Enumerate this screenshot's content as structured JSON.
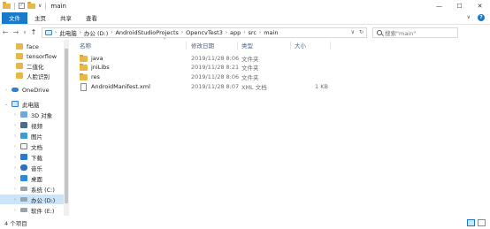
{
  "window": {
    "title": "main",
    "qat_arrow": "∨",
    "minimize": "—",
    "maximize": "☐",
    "close": "✕"
  },
  "ribbon": {
    "tabs": [
      "文件",
      "主页",
      "共享",
      "查看"
    ],
    "expand": "∨",
    "help": "?"
  },
  "nav": {
    "back": "←",
    "forward": "→",
    "recent": "∨",
    "up": "↑"
  },
  "address": {
    "crumbs": [
      "此电脑",
      "办公 (D:)",
      "AndroidStudioProjects",
      "OpencvTest3",
      "app",
      "src",
      "main"
    ],
    "separator": "›",
    "dropdown": "∨",
    "refresh": "↻"
  },
  "search": {
    "placeholder": "搜索\"main\""
  },
  "sidebar": {
    "items": [
      {
        "label": "face",
        "icon": "folder-icon"
      },
      {
        "label": "tensorflow",
        "icon": "folder-icon"
      },
      {
        "label": "二值化",
        "icon": "folder-icon"
      },
      {
        "label": "人脸识别",
        "icon": "folder-icon"
      },
      {
        "label": "OneDrive",
        "icon": "onedrive-icon"
      },
      {
        "label": "此电脑",
        "icon": "this-pc-icon"
      },
      {
        "label": "3D 对象",
        "icon": "3d-objects-icon"
      },
      {
        "label": "视频",
        "icon": "video-icon"
      },
      {
        "label": "图片",
        "icon": "pictures-icon"
      },
      {
        "label": "文档",
        "icon": "documents-icon"
      },
      {
        "label": "下载",
        "icon": "downloads-icon"
      },
      {
        "label": "音乐",
        "icon": "music-icon"
      },
      {
        "label": "桌面",
        "icon": "desktop-icon"
      },
      {
        "label": "系统 (C:)",
        "icon": "drive-icon"
      },
      {
        "label": "办公 (D:)",
        "icon": "drive-icon"
      },
      {
        "label": "软件 (E:)",
        "icon": "drive-icon"
      }
    ],
    "selected": "办公 (D:)"
  },
  "columns": {
    "name": "名称",
    "date": "修改日期",
    "type": "类型",
    "size": "大小",
    "sort_caret": "^"
  },
  "files": [
    {
      "name": "java",
      "date": "2019/11/28 8:06",
      "type": "文件夹",
      "size": "",
      "icon": "folder-icon"
    },
    {
      "name": "jniLibs",
      "date": "2019/11/28 8:21",
      "type": "文件夹",
      "size": "",
      "icon": "folder-icon"
    },
    {
      "name": "res",
      "date": "2019/11/28 8:06",
      "type": "文件夹",
      "size": "",
      "icon": "folder-icon"
    },
    {
      "name": "AndroidManifest.xml",
      "date": "2019/11/28 8:07",
      "type": "XML 文档",
      "size": "1 KB",
      "icon": "xml-file-icon"
    }
  ],
  "status": {
    "item_count": "4 个项目"
  },
  "colors": {
    "accent": "#1979ca",
    "selection": "#cce4f7",
    "folder": "#e8b74a"
  }
}
